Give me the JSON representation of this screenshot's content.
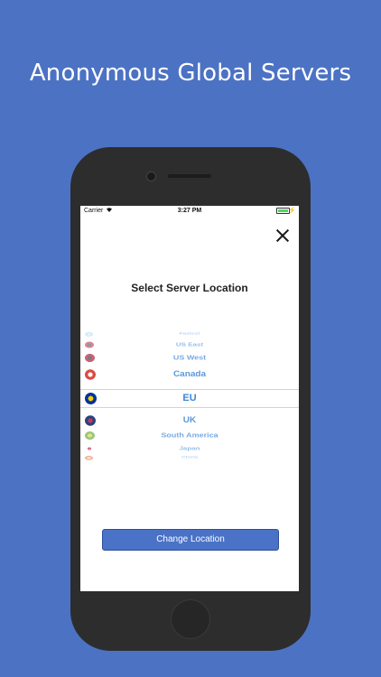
{
  "headline": "Anonymous Global Servers",
  "status_bar": {
    "carrier": "Carrier",
    "time": "3:27 PM"
  },
  "screen": {
    "title": "Select Server Location",
    "locations": [
      "Fastest",
      "US East",
      "US West",
      "Canada",
      "EU",
      "UK",
      "South America",
      "Japan",
      "China"
    ],
    "selected": "EU",
    "button_label": "Change Location"
  },
  "colors": {
    "background": "#4c72c4",
    "accent": "#3f86d6",
    "button": "#4a72c6"
  }
}
